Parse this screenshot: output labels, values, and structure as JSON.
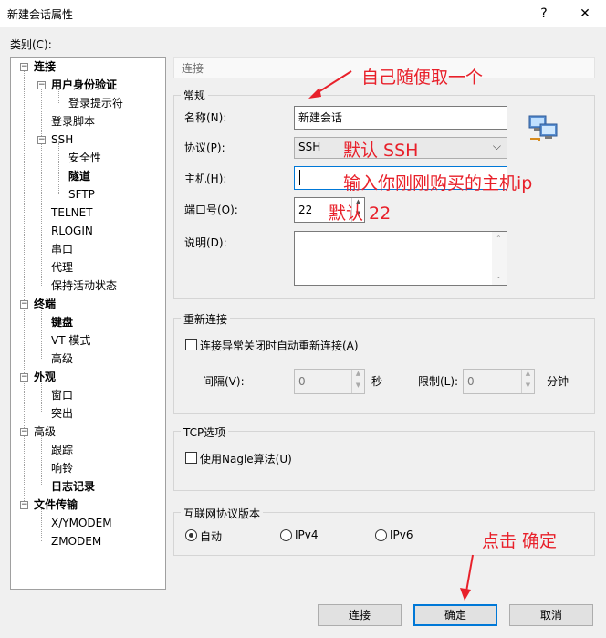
{
  "window": {
    "title": "新建会话属性",
    "help_glyph": "?",
    "close_glyph": "✕"
  },
  "category_label": "类别(C):",
  "tree": {
    "connection": "连接",
    "user_auth": "用户身份验证",
    "login_prompts": "登录提示符",
    "login_script": "登录脚本",
    "ssh": "SSH",
    "security": "安全性",
    "tunnel": "隧道",
    "sftp": "SFTP",
    "telnet": "TELNET",
    "rlogin": "RLOGIN",
    "serial": "串口",
    "proxy": "代理",
    "keepalive": "保持活动状态",
    "terminal": "终端",
    "keyboard": "键盘",
    "vt_mode": "VT 模式",
    "advanced": "高级",
    "appearance": "外观",
    "window": "窗口",
    "highlight": "突出",
    "advanced2": "高级",
    "trace": "跟踪",
    "bell": "响铃",
    "logging": "日志记录",
    "file_transfer": "文件传输",
    "xymodem": "X/YMODEM",
    "zmodem": "ZMODEM"
  },
  "panel_header": "连接",
  "general": {
    "group": "常规",
    "name_label": "名称(N):",
    "name_value": "新建会话",
    "protocol_label": "协议(P):",
    "protocol_value": "SSH",
    "host_label": "主机(H):",
    "host_value": "",
    "port_label": "端口号(O):",
    "port_value": "22",
    "desc_label": "说明(D):"
  },
  "reconnect": {
    "group": "重新连接",
    "checkbox_label": "连接异常关闭时自动重新连接(A)",
    "interval_label": "间隔(V):",
    "interval_value": "0",
    "interval_unit": "秒",
    "limit_label": "限制(L):",
    "limit_value": "0",
    "limit_unit": "分钟"
  },
  "tcp": {
    "group": "TCP选项",
    "nagle_label": "使用Nagle算法(U)"
  },
  "ip": {
    "group": "互联网协议版本",
    "auto": "自动",
    "ipv4": "IPv4",
    "ipv6": "IPv6",
    "selected": "自动"
  },
  "buttons": {
    "connect": "连接",
    "ok": "确定",
    "cancel": "取消"
  },
  "annotations": {
    "name_hint": "自己随便取一个",
    "protocol_hint": "默认 SSH",
    "host_hint": "输入你刚刚购买的主机ip",
    "port_hint": "默认 22",
    "ok_hint": "点击 确定",
    "color": "#e8202a"
  }
}
